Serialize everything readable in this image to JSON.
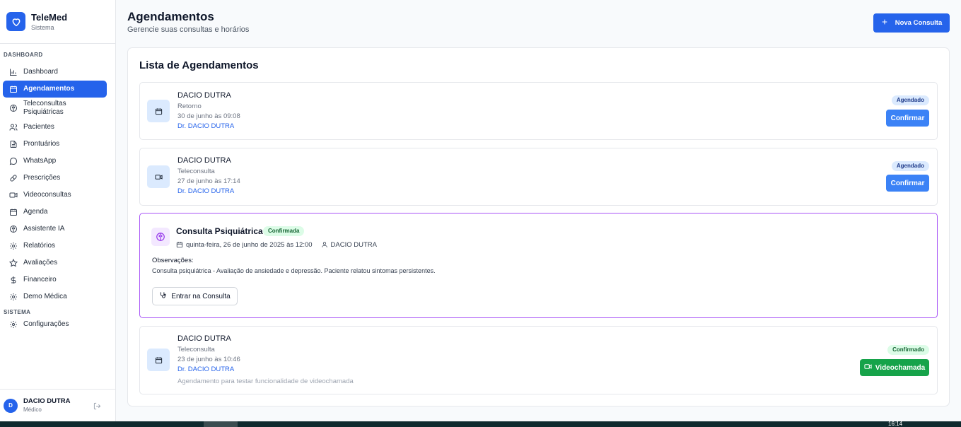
{
  "brand": {
    "title": "TeleMed",
    "subtitle": "Sistema"
  },
  "sidebar": {
    "section_dashboard": "DASHBOARD",
    "section_system": "SISTEMA",
    "items": [
      {
        "label": "Dashboard",
        "icon": "bar-chart-icon"
      },
      {
        "label": "Agendamentos",
        "icon": "calendar-icon",
        "active": true
      },
      {
        "label": "Teleconsultas Psiquiátricas",
        "icon": "brain-icon"
      },
      {
        "label": "Pacientes",
        "icon": "users-icon"
      },
      {
        "label": "Prontuários",
        "icon": "file-text-icon"
      },
      {
        "label": "WhatsApp",
        "icon": "message-circle-icon"
      },
      {
        "label": "Prescrições",
        "icon": "pill-icon"
      },
      {
        "label": "Videoconsultas",
        "icon": "video-icon"
      },
      {
        "label": "Agenda",
        "icon": "calendar-icon"
      },
      {
        "label": "Assistente IA",
        "icon": "brain-icon"
      },
      {
        "label": "Relatórios",
        "icon": "gear-icon"
      },
      {
        "label": "Avaliações",
        "icon": "star-icon"
      },
      {
        "label": "Financeiro",
        "icon": "dollar-icon"
      },
      {
        "label": "Demo Médica",
        "icon": "gear-icon"
      }
    ],
    "system_items": [
      {
        "label": "Configurações",
        "icon": "gear-icon"
      }
    ],
    "user": {
      "initial": "D",
      "name": "DACIO DUTRA",
      "role": "Médico"
    }
  },
  "header": {
    "title": "Agendamentos",
    "subtitle": "Gerencie suas consultas e horários",
    "new_button": "Nova Consulta"
  },
  "list": {
    "title": "Lista de Agendamentos",
    "appointments": [
      {
        "name": "DACIO DUTRA",
        "type": "Retorno",
        "date": "30 de junho às 09:08",
        "doctor": "Dr. DACIO DUTRA",
        "status": "Agendado",
        "action": "Confirmar",
        "icon": "calendar-icon"
      },
      {
        "name": "DACIO DUTRA",
        "type": "Teleconsulta",
        "date": "27 de junho às 17:14",
        "doctor": "Dr. DACIO DUTRA",
        "status": "Agendado",
        "action": "Confirmar",
        "icon": "video-icon"
      },
      {
        "name": "DACIO DUTRA",
        "type": "Teleconsulta",
        "date": "23 de junho às 10:46",
        "doctor": "Dr. DACIO DUTRA",
        "note": "Agendamento para testar funcionalidade de videochamada",
        "status": "Confirmado",
        "action": "Videochamada",
        "icon": "calendar-icon"
      }
    ],
    "psychiatric": {
      "title": "Consulta Psiquiátrica",
      "status": "Confirmada",
      "date": "quinta-feira, 26 de junho de 2025 às 12:00",
      "patient": "DACIO DUTRA",
      "obs_label": "Observações:",
      "obs": "Consulta psiquiátrica - Avaliação de ansiedade e depressão. Paciente relatou sintomas persistentes.",
      "action": "Entrar na Consulta"
    }
  },
  "taskbar": {
    "time": "16:14"
  },
  "colors": {
    "primary": "#2563eb",
    "success": "#16a34a",
    "psych": "#a855f7"
  }
}
